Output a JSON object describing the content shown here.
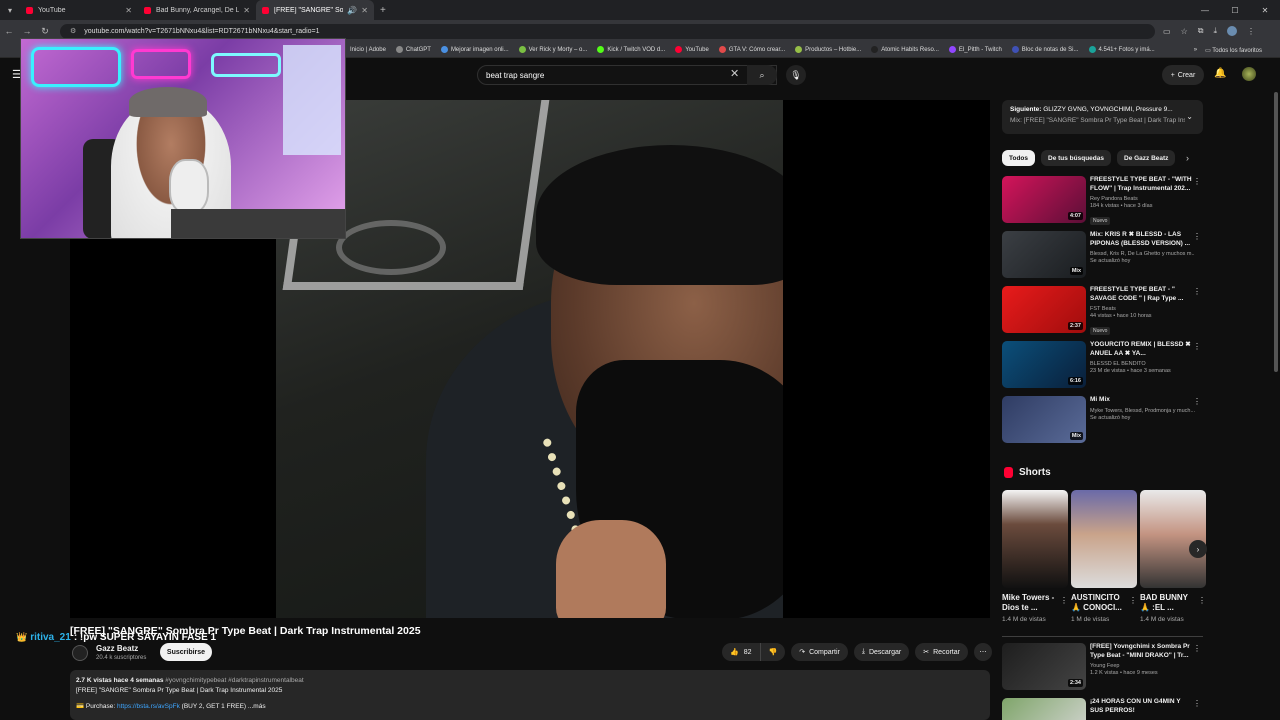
{
  "browser": {
    "tabs": [
      {
        "title": "YouTube"
      },
      {
        "title": "Bad Bunny, Arcangel, De La Gh..."
      },
      {
        "title": "[FREE] \"SANGRE\" Sombra P"
      }
    ],
    "url": "youtube.com/watch?v=T2671bNNxu4&list=RDT2671bNNxu4&start_radio=1",
    "bookmarks": [
      "Inicio | Adobe",
      "ChatGPT",
      "Mejorar imagen onli...",
      "Ver Rick y Morty – o...",
      "Kick / Twitch VOD d...",
      "YouTube",
      "GTA V: Cómo crear...",
      "Productos – Hotbie...",
      "Atomic Habits Reso...",
      "El_Pitth - Twitch",
      "Bloc de notas de Si...",
      "4.541+ Fotos y imá..."
    ],
    "bookmarks_all": "Todos los favoritos"
  },
  "header": {
    "search_value": "beat trap sangre",
    "create_label": "Crear"
  },
  "overlay_chat": {
    "user": "ritiva_21",
    "message": ": !pw SUPER SAYAYIN FASE 1"
  },
  "video": {
    "title": "[FREE] \"SANGRE\" Sombra Pr Type Beat | Dark Trap Instrumental 2025",
    "channel": "Gazz Beatz",
    "subscribers": "20.4 k suscriptores",
    "subscribe_label": "Suscribirse",
    "likes": "82",
    "share_label": "Compartir",
    "download_label": "Descargar",
    "clip_label": "Recortar",
    "desc_stats": "2.7 K vistas  hace 4 semanas",
    "desc_tags": "#yovngchimitypebeat #darktrapinstrumentalbeat",
    "desc_line2": "[FREE] \"SANGRE\" Sombra Pr Type Beat | Dark Trap Instrumental 2025",
    "desc_purchase": "Purchase:",
    "desc_link": "https://bsta.rs/avSpFk",
    "desc_tail": "(BUY 2, GET 1 FREE)  ...más"
  },
  "sidebar": {
    "upnext_label": "Siguiente:",
    "upnext_artists": "GLIZZY GVNG, YOVNGCHIMI, Pressure 9...",
    "upnext_mix": "Mix: [FREE] \"SANGRE\" Sombra Pr Type Beat | Dark Trap Instr...",
    "chips": [
      "Todos",
      "De tus búsquedas",
      "De Gazz Beatz"
    ],
    "recs": [
      {
        "title": "FREESTYLE TYPE BEAT - \"WITH FLOW\" | Trap Instrumental 202...",
        "channel": "Rey Pandora Beats",
        "meta": "184 k vistas • hace 3 días",
        "badge": "Nuevo",
        "duration": "4:07"
      },
      {
        "title": "Mix: KRIS R ✖ BLESSD - LAS PIPONAS (BLESSD VERSION) ...",
        "channel": "Blessd, Kris R, De La Ghetto y muchos m...",
        "meta": "Se actualizó hoy",
        "badge": "",
        "duration": "Mix"
      },
      {
        "title": "FREESTYLE TYPE BEAT - \" SAVAGE CODE \" | Rap Type ...",
        "channel": "FST Beats",
        "meta": "44 vistas • hace 10 horas",
        "badge": "Nuevo",
        "duration": "2:37"
      },
      {
        "title": "YOGURCITO REMIX | BLESSD ✖ ANUEL AA ✖ YA...",
        "channel": "BLESSD EL BENDITO",
        "meta": "23 M de vistas • hace 3 semanas",
        "badge": "",
        "duration": "6:16"
      },
      {
        "title": "Mi Mix",
        "channel": "Myke Towers, Blessd, Prodmonja y much...",
        "meta": "Se actualizó hoy",
        "badge": "",
        "duration": "Mix"
      }
    ],
    "shorts_label": "Shorts",
    "shorts": [
      {
        "title": "Mike Towers - Dios te ...",
        "views": "1.4 M de vistas"
      },
      {
        "title": "AUSTINCITO 🙏 CONOCI...",
        "views": "1 M de vistas"
      },
      {
        "title": "BAD BUNNY 🙏 :EL ...",
        "views": "1.4 M de vistas"
      }
    ],
    "recs2": [
      {
        "title": "[FREE] Yovngchimi x Sombra Pr Type Beat - \"MINI DRAKO\" | Tr...",
        "channel": "Young Feep",
        "meta": "1.2 K vistas • hace 9 meses",
        "duration": "2:34"
      },
      {
        "title": "¡24 HORAS CON UN G4MIN Y SUS PERROS!",
        "channel": "",
        "meta": "",
        "duration": ""
      }
    ]
  }
}
